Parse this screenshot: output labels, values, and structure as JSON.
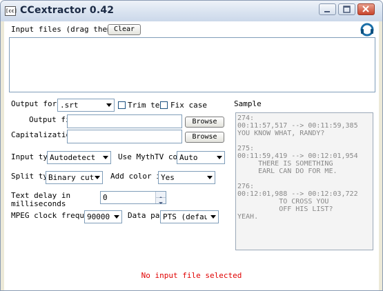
{
  "window": {
    "title": "CCextractor 0.42",
    "app_icon": "[cc]",
    "controls": [
      "minimize-icon",
      "maximize-icon",
      "close-icon"
    ]
  },
  "input": {
    "label": "Input files (drag them in)",
    "clear_button": "Clear",
    "help_icon": "help-icon"
  },
  "output_format": {
    "label": "Output format",
    "value": ".srt"
  },
  "trim_text": {
    "label": "Trim text",
    "checked": false
  },
  "fix_case": {
    "label": "Fix case",
    "checked": false
  },
  "output_file": {
    "label": "Output file",
    "value": "",
    "browse": "Browse"
  },
  "capitalization": {
    "label": "Capitalization",
    "value": "",
    "browse": "Browse"
  },
  "input_type": {
    "label": "Input type",
    "value": "Autodetect"
  },
  "use_mythtv": {
    "label": "Use MythTV code",
    "value": "Auto"
  },
  "split_type": {
    "label": "Split type",
    "value": "Binary cut"
  },
  "add_color": {
    "label": "Add color info",
    "value": "Yes"
  },
  "text_delay": {
    "label_line1": "Text delay in",
    "label_line2": "milliseconds",
    "value": "0"
  },
  "mpeg_clock": {
    "label": "MPEG clock frequency",
    "value": "90000"
  },
  "data_pad": {
    "label": "Data pad",
    "value": "PTS (default)"
  },
  "sample": {
    "label": "Sample",
    "lines": [
      "274:",
      "00:11:57,517 --> 00:11:59,385",
      "YOU KNOW WHAT, RANDY?",
      "",
      "275:",
      "00:11:59,419 --> 00:12:01,954",
      "     THERE IS SOMETHING",
      "     EARL CAN DO FOR ME.",
      "",
      "276:",
      "00:12:01,988 --> 00:12:03,722",
      "          TO CROSS YOU",
      "          OFF HIS LIST?",
      "YEAH."
    ]
  },
  "status": {
    "text": "No input file selected",
    "color": "#e00000"
  }
}
